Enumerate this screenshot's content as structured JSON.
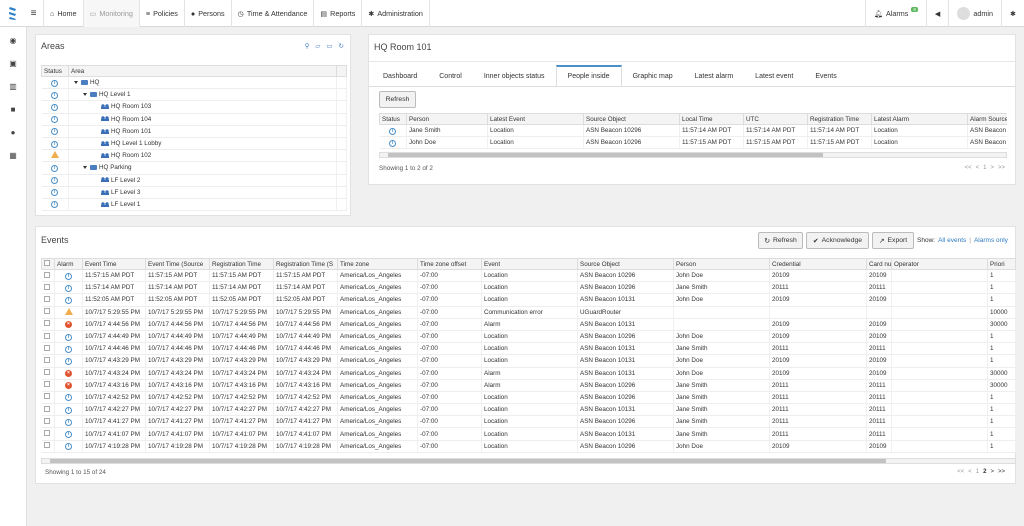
{
  "nav": {
    "home": "Home",
    "monitoring": "Monitoring",
    "policies": "Policies",
    "persons": "Persons",
    "time": "Time & Attendance",
    "reports": "Reports",
    "administration": "Administration",
    "alarms": "Alarms",
    "alarms_count": "8",
    "user": "admin"
  },
  "areas": {
    "title": "Areas",
    "col_status": "Status",
    "col_area": "Area",
    "rows": [
      {
        "status": "info",
        "level": 0,
        "type": "folder",
        "label": "HQ"
      },
      {
        "status": "info",
        "level": 1,
        "type": "folder",
        "label": "HQ Level 1"
      },
      {
        "status": "info",
        "level": 2,
        "type": "room",
        "label": "HQ Room 103"
      },
      {
        "status": "info",
        "level": 2,
        "type": "room",
        "label": "HQ Room 104"
      },
      {
        "status": "info",
        "level": 2,
        "type": "room",
        "label": "HQ Room 101"
      },
      {
        "status": "info",
        "level": 2,
        "type": "room",
        "label": "HQ Level 1 Lobby"
      },
      {
        "status": "warn",
        "level": 2,
        "type": "room",
        "label": "HQ Room 102"
      },
      {
        "status": "info",
        "level": 1,
        "type": "folder",
        "label": "HQ Parking"
      },
      {
        "status": "info",
        "level": 2,
        "type": "room",
        "label": "LF Level 2"
      },
      {
        "status": "info",
        "level": 2,
        "type": "room",
        "label": "LF Level 3"
      },
      {
        "status": "info",
        "level": 2,
        "type": "room",
        "label": "LF Level 1"
      }
    ]
  },
  "room": {
    "title": "HQ Room 101",
    "tabs": [
      "Dashboard",
      "Control",
      "Inner objects status",
      "People inside",
      "Graphic map",
      "Latest alarm",
      "Latest event",
      "Events"
    ],
    "active_tab": "People inside",
    "refresh": "Refresh",
    "columns": [
      "Status",
      "Person",
      "Latest Event",
      "Source Object",
      "Local Time",
      "UTC",
      "Registration Time",
      "Latest Alarm",
      "Alarm Source"
    ],
    "rows": [
      [
        "info",
        "Jane Smith",
        "Location",
        "ASN Beacon 10296",
        "11:57:14 AM PDT",
        "11:57:14 AM PDT",
        "11:57:14 AM PDT",
        "Location",
        "ASN Beacon"
      ],
      [
        "info",
        "John Doe",
        "Location",
        "ASN Beacon 10296",
        "11:57:15 AM PDT",
        "11:57:15 AM PDT",
        "11:57:15 AM PDT",
        "Location",
        "ASN Beacon"
      ]
    ],
    "showing": "Showing 1 to 2 of 2",
    "pager": [
      "<<",
      "<",
      "1",
      ">",
      ">>"
    ]
  },
  "events": {
    "title": "Events",
    "refresh": "Refresh",
    "acknowledge": "Acknowledge",
    "export": "Export",
    "show_label": "Show:",
    "all_events": "All events",
    "alarms_only": "Alarms only",
    "columns": [
      "",
      "Alarm",
      "Event Time",
      "Event Time (Source",
      "Registration Time",
      "Registration Time (S",
      "Time zone",
      "Time zone offset",
      "Event",
      "Source Object",
      "Person",
      "Credential",
      "Card nu",
      "Operator",
      "Priori"
    ],
    "rows": [
      [
        "info",
        "11:57:15 AM PDT",
        "11:57:15 AM PDT",
        "11:57:15 AM PDT",
        "11:57:15 AM PDT",
        "America/Los_Angeles",
        "-07:00",
        "Location",
        "ASN Beacon 10296",
        "John Doe",
        "20109",
        "20109",
        "",
        "1"
      ],
      [
        "info",
        "11:57:14 AM PDT",
        "11:57:14 AM PDT",
        "11:57:14 AM PDT",
        "11:57:14 AM PDT",
        "America/Los_Angeles",
        "-07:00",
        "Location",
        "ASN Beacon 10296",
        "Jane Smith",
        "20111",
        "20111",
        "",
        "1"
      ],
      [
        "info",
        "11:52:05 AM PDT",
        "11:52:05 AM PDT",
        "11:52:05 AM PDT",
        "11:52:05 AM PDT",
        "America/Los_Angeles",
        "-07:00",
        "Location",
        "ASN Beacon 10131",
        "John Doe",
        "20109",
        "20109",
        "",
        "1"
      ],
      [
        "warn",
        "10/7/17 5:29:55 PM",
        "10/7/17 5:29:55 PM",
        "10/7/17 5:29:55 PM",
        "10/7/17 5:29:55 PM",
        "America/Los_Angeles",
        "-07:00",
        "Communication error",
        "UGuardRouter",
        "",
        "",
        "",
        "",
        "10000"
      ],
      [
        "err",
        "10/7/17 4:44:56 PM",
        "10/7/17 4:44:56 PM",
        "10/7/17 4:44:56 PM",
        "10/7/17 4:44:56 PM",
        "America/Los_Angeles",
        "-07:00",
        "Alarm",
        "ASN Beacon 10131",
        "",
        "20109",
        "20109",
        "",
        "30000"
      ],
      [
        "info",
        "10/7/17 4:44:49 PM",
        "10/7/17 4:44:49 PM",
        "10/7/17 4:44:49 PM",
        "10/7/17 4:44:49 PM",
        "America/Los_Angeles",
        "-07:00",
        "Location",
        "ASN Beacon 10296",
        "John Doe",
        "20109",
        "20109",
        "",
        "1"
      ],
      [
        "info",
        "10/7/17 4:44:46 PM",
        "10/7/17 4:44:46 PM",
        "10/7/17 4:44:46 PM",
        "10/7/17 4:44:46 PM",
        "America/Los_Angeles",
        "-07:00",
        "Location",
        "ASN Beacon 10131",
        "Jane Smith",
        "20111",
        "20111",
        "",
        "1"
      ],
      [
        "info",
        "10/7/17 4:43:29 PM",
        "10/7/17 4:43:29 PM",
        "10/7/17 4:43:29 PM",
        "10/7/17 4:43:29 PM",
        "America/Los_Angeles",
        "-07:00",
        "Location",
        "ASN Beacon 10131",
        "John Doe",
        "20109",
        "20109",
        "",
        "1"
      ],
      [
        "err",
        "10/7/17 4:43:24 PM",
        "10/7/17 4:43:24 PM",
        "10/7/17 4:43:24 PM",
        "10/7/17 4:43:24 PM",
        "America/Los_Angeles",
        "-07:00",
        "Alarm",
        "ASN Beacon 10131",
        "John Doe",
        "20109",
        "20109",
        "",
        "30000"
      ],
      [
        "err",
        "10/7/17 4:43:16 PM",
        "10/7/17 4:43:16 PM",
        "10/7/17 4:43:16 PM",
        "10/7/17 4:43:16 PM",
        "America/Los_Angeles",
        "-07:00",
        "Alarm",
        "ASN Beacon 10296",
        "Jane Smith",
        "20111",
        "20111",
        "",
        "30000"
      ],
      [
        "info",
        "10/7/17 4:42:52 PM",
        "10/7/17 4:42:52 PM",
        "10/7/17 4:42:52 PM",
        "10/7/17 4:42:52 PM",
        "America/Los_Angeles",
        "-07:00",
        "Location",
        "ASN Beacon 10296",
        "Jane Smith",
        "20111",
        "20111",
        "",
        "1"
      ],
      [
        "info",
        "10/7/17 4:42:27 PM",
        "10/7/17 4:42:27 PM",
        "10/7/17 4:42:27 PM",
        "10/7/17 4:42:27 PM",
        "America/Los_Angeles",
        "-07:00",
        "Location",
        "ASN Beacon 10131",
        "Jane Smith",
        "20111",
        "20111",
        "",
        "1"
      ],
      [
        "info",
        "10/7/17 4:41:27 PM",
        "10/7/17 4:41:27 PM",
        "10/7/17 4:41:27 PM",
        "10/7/17 4:41:27 PM",
        "America/Los_Angeles",
        "-07:00",
        "Location",
        "ASN Beacon 10296",
        "Jane Smith",
        "20111",
        "20111",
        "",
        "1"
      ],
      [
        "info",
        "10/7/17 4:41:07 PM",
        "10/7/17 4:41:07 PM",
        "10/7/17 4:41:07 PM",
        "10/7/17 4:41:07 PM",
        "America/Los_Angeles",
        "-07:00",
        "Location",
        "ASN Beacon 10131",
        "Jane Smith",
        "20111",
        "20111",
        "",
        "1"
      ],
      [
        "info",
        "10/7/17 4:19:28 PM",
        "10/7/17 4:19:28 PM",
        "10/7/17 4:19:28 PM",
        "10/7/17 4:19:28 PM",
        "America/Los_Angeles",
        "-07:00",
        "Location",
        "ASN Beacon 10296",
        "John Doe",
        "20109",
        "20109",
        "",
        "1"
      ]
    ],
    "showing": "Showing 1 to 15 of 24",
    "pager": [
      "<<",
      "<",
      "1",
      "2",
      ">",
      ">>"
    ],
    "current_page": "2"
  },
  "icons": {
    "left": [
      "dashboard-icon",
      "floorplan-icon",
      "map-icon",
      "camera-icon",
      "location-pin-icon",
      "table-icon"
    ]
  }
}
